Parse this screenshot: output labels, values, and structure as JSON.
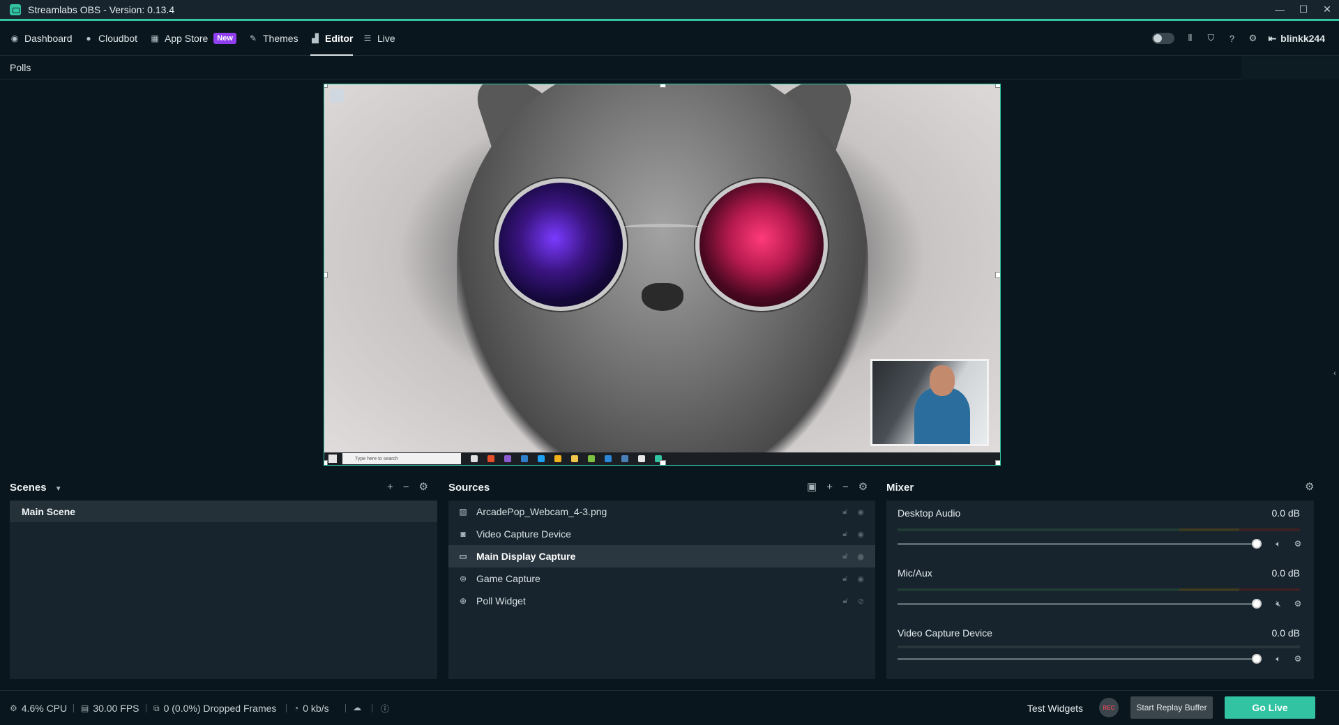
{
  "window": {
    "title": "Streamlabs OBS - Version: 0.13.4",
    "controls": [
      "—",
      "☐",
      "✕"
    ]
  },
  "nav": {
    "items": [
      {
        "label": "Dashboard",
        "icon": "dashboard-icon"
      },
      {
        "label": "Cloudbot",
        "icon": "cloudbot-icon"
      },
      {
        "label": "App Store",
        "icon": "store-icon",
        "badge": "New"
      },
      {
        "label": "Themes",
        "icon": "themes-icon"
      },
      {
        "label": "Editor",
        "icon": "editor-icon",
        "active": true
      },
      {
        "label": "Live",
        "icon": "live-icon"
      }
    ],
    "user": "blinkk244"
  },
  "polls": {
    "label": "Polls"
  },
  "preview": {
    "taskbar_search": "Type here to search"
  },
  "scenes": {
    "title": "Scenes",
    "items": [
      "Main Scene"
    ]
  },
  "sources": {
    "title": "Sources",
    "items": [
      {
        "label": "ArcadePop_Webcam_4-3.png",
        "icon": "image-icon"
      },
      {
        "label": "Video Capture Device",
        "icon": "webcam-icon"
      },
      {
        "label": "Main Display Capture",
        "icon": "monitor-icon",
        "selected": true
      },
      {
        "label": "Game Capture",
        "icon": "gamepad-icon"
      },
      {
        "label": "Poll Widget",
        "icon": "globe-icon"
      }
    ]
  },
  "mixer": {
    "title": "Mixer",
    "channels": [
      {
        "name": "Desktop Audio",
        "db": "0.0 dB",
        "level": 1.0
      },
      {
        "name": "Mic/Aux",
        "db": "0.0 dB",
        "level": 1.0
      },
      {
        "name": "Video Capture Device",
        "db": "0.0 dB",
        "level": 1.0
      }
    ]
  },
  "footer": {
    "cpu": "4.6% CPU",
    "fps": "30.00 FPS",
    "dropped": "0 (0.0%) Dropped Frames",
    "bandwidth": "0 kb/s",
    "test_widgets": "Test Widgets",
    "rec": "REC",
    "replay": "Start Replay Buffer",
    "go_live": "Go Live"
  },
  "colors": {
    "accent": "#31c3a2",
    "badge": "#8f3ff0",
    "background": "#09161d",
    "panel": "#17242d"
  }
}
